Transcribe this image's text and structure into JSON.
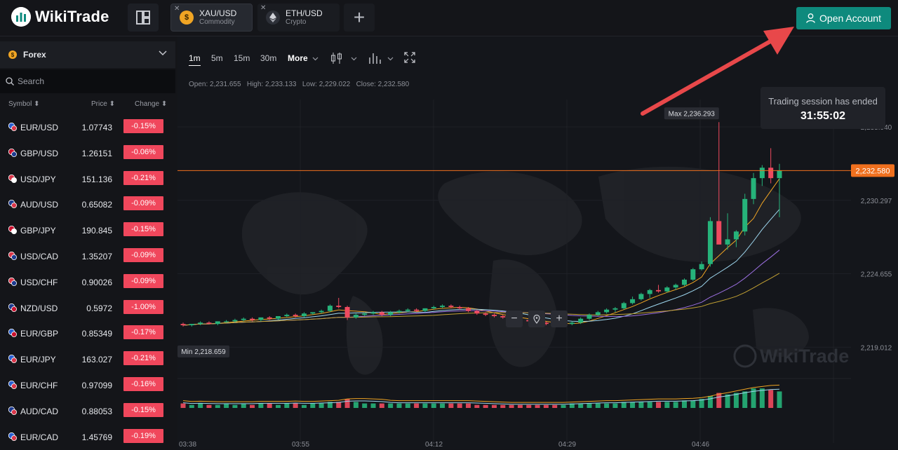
{
  "app": {
    "logo_text": "WikiTrade",
    "open_account_label": "Open Account"
  },
  "tabs": [
    {
      "name": "XAU/USD",
      "sub": "Commodity",
      "icon": "gold-coin-icon",
      "color": "#f0a524"
    },
    {
      "name": "ETH/USD",
      "sub": "Crypto",
      "icon": "ethereum-icon",
      "color": "#d0d2d8"
    }
  ],
  "sidebar": {
    "category": "Forex",
    "search_placeholder": "Search",
    "columns": {
      "symbol": "Symbol",
      "price": "Price",
      "change": "Change"
    },
    "rows": [
      {
        "symbol": "EUR/USD",
        "price": "1.07743",
        "change": "-0.15%"
      },
      {
        "symbol": "GBP/USD",
        "price": "1.26151",
        "change": "-0.06%"
      },
      {
        "symbol": "USD/JPY",
        "price": "151.136",
        "change": "-0.21%"
      },
      {
        "symbol": "AUD/USD",
        "price": "0.65082",
        "change": "-0.09%"
      },
      {
        "symbol": "GBP/JPY",
        "price": "190.845",
        "change": "-0.15%"
      },
      {
        "symbol": "USD/CAD",
        "price": "1.35207",
        "change": "-0.09%"
      },
      {
        "symbol": "USD/CHF",
        "price": "0.90026",
        "change": "-0.09%"
      },
      {
        "symbol": "NZD/USD",
        "price": "0.5972",
        "change": "-1.00%"
      },
      {
        "symbol": "EUR/GBP",
        "price": "0.85349",
        "change": "-0.17%"
      },
      {
        "symbol": "EUR/JPY",
        "price": "163.027",
        "change": "-0.21%"
      },
      {
        "symbol": "EUR/CHF",
        "price": "0.97099",
        "change": "-0.16%"
      },
      {
        "symbol": "AUD/CAD",
        "price": "0.88053",
        "change": "-0.15%"
      },
      {
        "symbol": "EUR/CAD",
        "price": "1.45769",
        "change": "-0.19%"
      }
    ]
  },
  "toolbar": {
    "timeframes": [
      "1m",
      "5m",
      "15m",
      "30m",
      "More"
    ],
    "selected": "1m"
  },
  "ohlc": {
    "open": "Open: 2,231.655",
    "high": "High: 2,233.133",
    "low": "Low: 2,229.022",
    "close": "Close: 2,232.580"
  },
  "session": {
    "message": "Trading session has ended",
    "countdown": "31:55:02"
  },
  "chart_data": {
    "type": "candlestick",
    "y_ticks": [
      "2,235.940",
      "2,230.297",
      "2,224.655",
      "2,219.012"
    ],
    "x_ticks": [
      "03:38",
      "03:55",
      "04:12",
      "04:29",
      "04:46"
    ],
    "current_price": "2,232.580",
    "max_label": "Max 2,236.293",
    "min_label": "Min 2,218.659",
    "watermark": "WikiTrade",
    "ylim": [
      2216.5,
      2237.5
    ],
    "colors": {
      "up": "#26b37a",
      "down": "#ef4a5f",
      "price_line": "#f0701e",
      "ma_fast": "#f0a524",
      "ma_mid": "#9fd8f0",
      "ma_slow": "#9b6fe0",
      "ma_long": "#c3a233"
    },
    "candles": [
      [
        2220.8,
        2220.9,
        2220.6,
        2220.7
      ],
      [
        2220.7,
        2220.8,
        2220.6,
        2220.8
      ],
      [
        2220.8,
        2221.0,
        2220.7,
        2220.9
      ],
      [
        2220.9,
        2221.0,
        2220.8,
        2220.8
      ],
      [
        2220.8,
        2221.0,
        2220.7,
        2221.0
      ],
      [
        2221.0,
        2221.1,
        2220.9,
        2221.0
      ],
      [
        2221.0,
        2221.2,
        2220.9,
        2221.1
      ],
      [
        2221.1,
        2221.3,
        2221.0,
        2221.2
      ],
      [
        2221.2,
        2221.3,
        2221.0,
        2221.1
      ],
      [
        2221.1,
        2221.3,
        2221.0,
        2221.3
      ],
      [
        2221.3,
        2221.4,
        2221.1,
        2221.2
      ],
      [
        2221.2,
        2221.4,
        2221.1,
        2221.4
      ],
      [
        2221.4,
        2221.6,
        2221.3,
        2221.5
      ],
      [
        2221.5,
        2221.6,
        2221.3,
        2221.4
      ],
      [
        2221.4,
        2221.7,
        2221.3,
        2221.6
      ],
      [
        2221.6,
        2221.7,
        2221.5,
        2221.7
      ],
      [
        2221.7,
        2221.9,
        2221.6,
        2221.8
      ],
      [
        2221.8,
        2222.3,
        2221.7,
        2222.2
      ],
      [
        2222.2,
        2222.8,
        2222.0,
        2222.1
      ],
      [
        2222.1,
        2222.2,
        2221.1,
        2221.3
      ],
      [
        2221.3,
        2221.6,
        2221.2,
        2221.5
      ],
      [
        2221.5,
        2221.7,
        2221.4,
        2221.6
      ],
      [
        2221.6,
        2221.8,
        2221.5,
        2221.7
      ],
      [
        2221.7,
        2221.8,
        2221.4,
        2221.5
      ],
      [
        2221.5,
        2221.8,
        2221.4,
        2221.7
      ],
      [
        2221.7,
        2221.9,
        2221.6,
        2221.8
      ],
      [
        2221.8,
        2222.0,
        2221.7,
        2221.9
      ],
      [
        2221.9,
        2222.0,
        2221.7,
        2221.8
      ],
      [
        2221.8,
        2222.0,
        2221.7,
        2222.0
      ],
      [
        2222.0,
        2222.2,
        2221.9,
        2222.1
      ],
      [
        2222.1,
        2222.3,
        2222.0,
        2222.2
      ],
      [
        2222.2,
        2222.3,
        2222.0,
        2222.1
      ],
      [
        2222.1,
        2222.2,
        2221.9,
        2222.0
      ],
      [
        2222.0,
        2222.1,
        2221.7,
        2221.8
      ],
      [
        2221.8,
        2221.9,
        2221.5,
        2221.6
      ],
      [
        2221.6,
        2221.7,
        2221.4,
        2221.5
      ],
      [
        2221.5,
        2221.6,
        2221.3,
        2221.4
      ],
      [
        2221.4,
        2221.5,
        2221.2,
        2221.3
      ],
      [
        2221.3,
        2221.4,
        2221.1,
        2221.2
      ],
      [
        2221.2,
        2221.3,
        2221.0,
        2221.1
      ],
      [
        2221.1,
        2221.2,
        2220.9,
        2221.0
      ],
      [
        2221.0,
        2221.1,
        2220.8,
        2220.9
      ],
      [
        2220.9,
        2221.0,
        2220.7,
        2220.8
      ],
      [
        2220.8,
        2220.9,
        2220.6,
        2220.7
      ],
      [
        2220.7,
        2220.9,
        2220.6,
        2220.8
      ],
      [
        2220.8,
        2221.0,
        2220.7,
        2220.9
      ],
      [
        2220.9,
        2221.3,
        2220.8,
        2221.2
      ],
      [
        2221.2,
        2221.6,
        2221.1,
        2221.5
      ],
      [
        2221.5,
        2221.8,
        2221.4,
        2221.7
      ],
      [
        2221.7,
        2222.0,
        2221.6,
        2221.9
      ],
      [
        2221.9,
        2222.1,
        2221.7,
        2222.0
      ],
      [
        2222.0,
        2222.5,
        2221.9,
        2222.4
      ],
      [
        2222.4,
        2222.9,
        2222.3,
        2222.7
      ],
      [
        2222.7,
        2223.2,
        2222.6,
        2223.1
      ],
      [
        2223.1,
        2223.5,
        2222.8,
        2223.4
      ],
      [
        2223.4,
        2223.8,
        2223.2,
        2223.3
      ],
      [
        2223.3,
        2223.7,
        2223.2,
        2223.6
      ],
      [
        2223.6,
        2223.9,
        2223.4,
        2223.8
      ],
      [
        2223.8,
        2224.3,
        2223.7,
        2224.2
      ],
      [
        2224.2,
        2225.1,
        2224.1,
        2225.0
      ],
      [
        2225.0,
        2225.6,
        2224.9,
        2225.4
      ],
      [
        2225.4,
        2229.0,
        2225.2,
        2228.7
      ],
      [
        2228.7,
        2236.3,
        2228.5,
        2226.9
      ],
      [
        2226.9,
        2229.3,
        2226.5,
        2227.3
      ],
      [
        2227.3,
        2228.0,
        2226.7,
        2227.9
      ],
      [
        2227.9,
        2230.8,
        2227.6,
        2230.4
      ],
      [
        2230.4,
        2232.4,
        2230.0,
        2232.0
      ],
      [
        2232.0,
        2233.0,
        2231.4,
        2232.8
      ],
      [
        2232.8,
        2234.3,
        2231.6,
        2232.0
      ],
      [
        2232.0,
        2233.1,
        2229.0,
        2232.6
      ]
    ],
    "volume": [
      3,
      2,
      3,
      2,
      2,
      3,
      2,
      3,
      2,
      3,
      3,
      2,
      3,
      3,
      2,
      3,
      3,
      4,
      4,
      6,
      4,
      3,
      3,
      3,
      3,
      3,
      3,
      3,
      3,
      3,
      3,
      3,
      3,
      3,
      2,
      2,
      2,
      2,
      2,
      2,
      2,
      2,
      2,
      2,
      2,
      3,
      3,
      3,
      3,
      3,
      3,
      4,
      4,
      4,
      4,
      4,
      4,
      4,
      5,
      5,
      6,
      8,
      10,
      9,
      10,
      11,
      13,
      13,
      12,
      11
    ]
  }
}
